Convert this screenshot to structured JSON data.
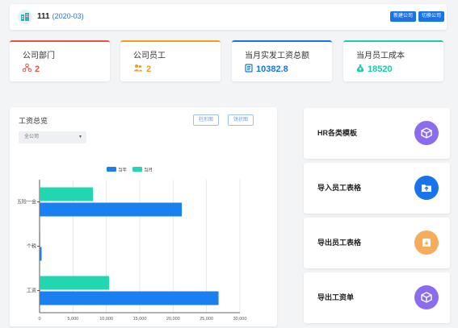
{
  "header": {
    "company_id": "111",
    "period": "(2020-03)",
    "new_company_label": "新建公司",
    "switch_company_label": "切换公司"
  },
  "stats": [
    {
      "label": "公司部门",
      "value": "2",
      "color": "#e8514b",
      "icon": "org-chart-icon"
    },
    {
      "label": "公司员工",
      "value": "2",
      "color": "#f0a020",
      "icon": "users-icon"
    },
    {
      "label": "当月实发工资总额",
      "value": "10382.8",
      "color": "#1a73e8",
      "icon": "book-icon"
    },
    {
      "label": "当月员工成本",
      "value": "18520",
      "color": "#22c9a6",
      "icon": "money-bag-icon"
    }
  ],
  "salary_overview": {
    "title": "工资总览",
    "bar_chart_button": "柱形图",
    "pie_chart_button": "饼状图",
    "company_filter": "全公司"
  },
  "chart_data": {
    "type": "bar",
    "orientation": "horizontal",
    "categories": [
      "五险一金",
      "个税",
      "工资"
    ],
    "series": [
      {
        "name": "当年",
        "color": "#1a7ff0",
        "values": [
          21300,
          300,
          26800
        ]
      },
      {
        "name": "当月",
        "color": "#22d6b0",
        "values": [
          8000,
          100,
          10400
        ]
      }
    ],
    "x_ticks": [
      "0",
      "5,000",
      "10,000",
      "15,000",
      "20,000",
      "25,000",
      "30,000"
    ],
    "xlim": [
      0,
      30000
    ],
    "grid": true,
    "legend_position": "top"
  },
  "actions": [
    {
      "label": "HR各类模板",
      "icon": "cube-icon",
      "color": "#8b6cf0"
    },
    {
      "label": "导入员工表格",
      "icon": "upload-icon",
      "color": "#1a73e8"
    },
    {
      "label": "导出员工表格",
      "icon": "download-icon",
      "color": "#f5ac5b"
    },
    {
      "label": "导出工资单",
      "icon": "cube-icon",
      "color": "#8b6cf0"
    }
  ]
}
